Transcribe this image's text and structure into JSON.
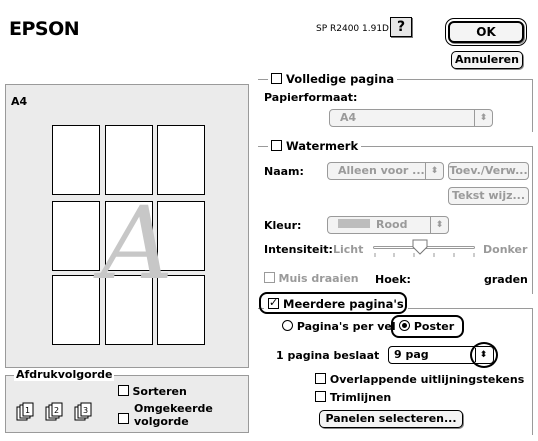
{
  "header": {
    "brand": "EPSON",
    "model": "SP R2400 1.91D",
    "help_label": "?",
    "ok_label": "OK",
    "cancel_label": "Annuleren"
  },
  "preview": {
    "paper_label": "A4",
    "letter": "A"
  },
  "print_order": {
    "title": "Afdrukvolgorde",
    "sort_label": "Sorteren",
    "reverse_label_1": "Omgekeerde",
    "reverse_label_2": "volgorde",
    "sort_checked": false,
    "reverse_checked": false
  },
  "full_page": {
    "label": "Volledige pagina",
    "checked": false,
    "paper_format_label": "Papierformaat:",
    "paper_format_value": "A4"
  },
  "watermark": {
    "label": "Watermerk",
    "checked": false,
    "name_label": "Naam:",
    "name_value": "Alleen voor ...",
    "add_button": "Toev./Verw...",
    "text_button": "Tekst wijz...",
    "color_label": "Kleur:",
    "color_value": "Rood",
    "intensity_label": "Intensiteit:",
    "intensity_low": "Licht",
    "intensity_high": "Donker",
    "intensity_level": 0.5,
    "rotate_label": "Muis draaien",
    "angle_label": "Hoek:",
    "angle_unit": "graden"
  },
  "multipage": {
    "label": "Meerdere pagina's",
    "checked": true,
    "pages_per_sheet_label": "Pagina's per vel",
    "poster_label": "Poster",
    "poster_selected": true,
    "page_covers_label": "1 pagina beslaat",
    "page_covers_value": "9 pag",
    "overlap_label": "Overlappende uitlijningstekens",
    "overlap_checked": false,
    "trim_label": "Trimlijnen",
    "trim_checked": false,
    "select_panels_button": "Panelen selecteren..."
  }
}
